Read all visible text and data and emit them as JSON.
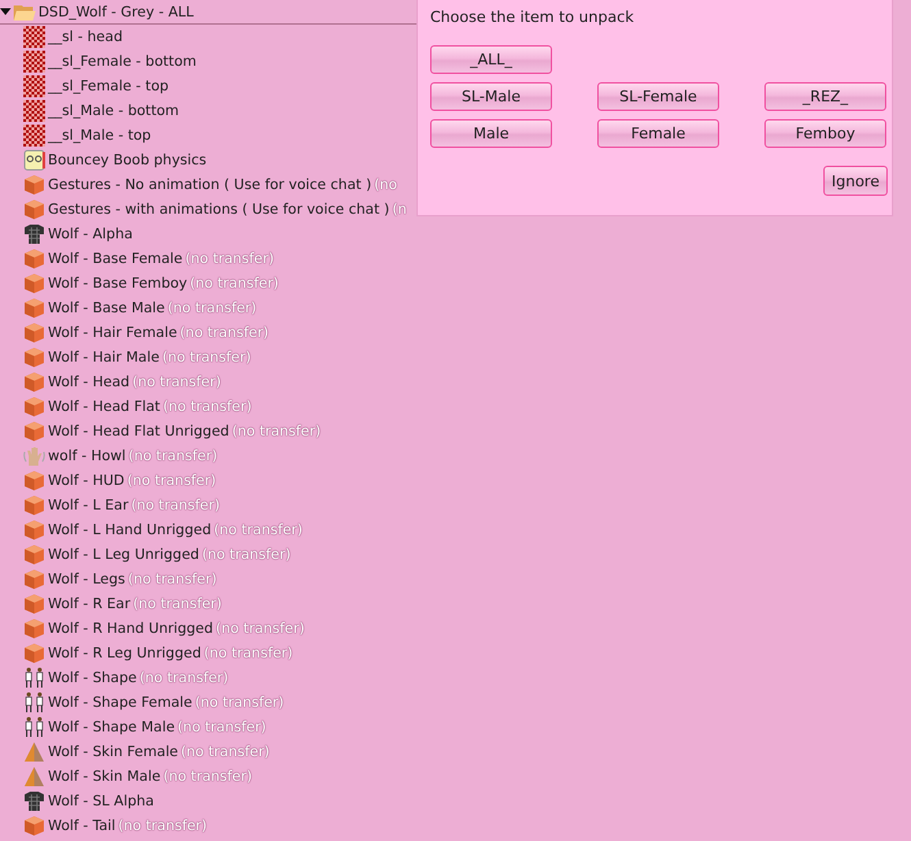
{
  "folder": {
    "name": "DSD_Wolf - Grey - ALL",
    "expanded": true,
    "children": [
      {
        "kind": "texture",
        "name": "__sl - head"
      },
      {
        "kind": "texture",
        "name": "__sl_Female - bottom"
      },
      {
        "kind": "texture",
        "name": "__sl_Female - top"
      },
      {
        "kind": "texture",
        "name": "__sl_Male - bottom"
      },
      {
        "kind": "texture",
        "name": "__sl_Male - top"
      },
      {
        "kind": "physics",
        "name": "Bouncey Boob physics"
      },
      {
        "kind": "object",
        "name": "Gestures - No animation ( Use for voice chat )",
        "note": "(no"
      },
      {
        "kind": "object",
        "name": "Gestures - with animations ( Use for voice chat )",
        "note": "(n"
      },
      {
        "kind": "clothing",
        "name": "Wolf - Alpha"
      },
      {
        "kind": "object",
        "name": "Wolf - Base Female",
        "note": "(no transfer)"
      },
      {
        "kind": "object",
        "name": "Wolf - Base Femboy",
        "note": "(no transfer)"
      },
      {
        "kind": "object",
        "name": "Wolf - Base Male",
        "note": "(no transfer)"
      },
      {
        "kind": "object",
        "name": "Wolf - Hair Female",
        "note": "(no transfer)"
      },
      {
        "kind": "object",
        "name": "Wolf - Hair Male",
        "note": "(no transfer)"
      },
      {
        "kind": "object",
        "name": "Wolf - Head",
        "note": "(no transfer)"
      },
      {
        "kind": "object",
        "name": "Wolf - Head Flat",
        "note": "(no transfer)"
      },
      {
        "kind": "object",
        "name": "Wolf - Head Flat Unrigged",
        "note": "(no transfer)"
      },
      {
        "kind": "gesture",
        "name": "wolf - Howl",
        "note": "(no transfer)"
      },
      {
        "kind": "object",
        "name": "Wolf - HUD",
        "note": "(no transfer)"
      },
      {
        "kind": "object",
        "name": "Wolf - L Ear",
        "note": "(no transfer)"
      },
      {
        "kind": "object",
        "name": "Wolf - L Hand Unrigged",
        "note": "(no transfer)"
      },
      {
        "kind": "object",
        "name": "Wolf - L Leg Unrigged",
        "note": "(no transfer)"
      },
      {
        "kind": "object",
        "name": "Wolf - Legs",
        "note": "(no transfer)"
      },
      {
        "kind": "object",
        "name": "Wolf - R Ear",
        "note": "(no transfer)"
      },
      {
        "kind": "object",
        "name": "Wolf - R Hand Unrigged",
        "note": "(no transfer)"
      },
      {
        "kind": "object",
        "name": "Wolf - R Leg Unrigged",
        "note": "(no transfer)"
      },
      {
        "kind": "shape",
        "name": "Wolf - Shape",
        "note": "(no transfer)"
      },
      {
        "kind": "shape",
        "name": "Wolf - Shape Female",
        "note": "(no transfer)"
      },
      {
        "kind": "shape",
        "name": "Wolf - Shape Male",
        "note": "(no transfer)"
      },
      {
        "kind": "skin",
        "name": "Wolf - Skin Female",
        "note": "(no transfer)"
      },
      {
        "kind": "skin",
        "name": "Wolf - Skin Male",
        "note": "(no transfer)"
      },
      {
        "kind": "clothing",
        "name": "Wolf - SL Alpha"
      },
      {
        "kind": "object",
        "name": "Wolf - Tail",
        "note": "(no transfer)"
      }
    ]
  },
  "dialog": {
    "message": "Choose the item to unpack",
    "buttons": [
      [
        "_ALL_"
      ],
      [
        "SL-Male",
        "SL-Female",
        "_REZ_"
      ],
      [
        "Male",
        "Female",
        "Femboy"
      ]
    ],
    "ignore": "Ignore"
  }
}
